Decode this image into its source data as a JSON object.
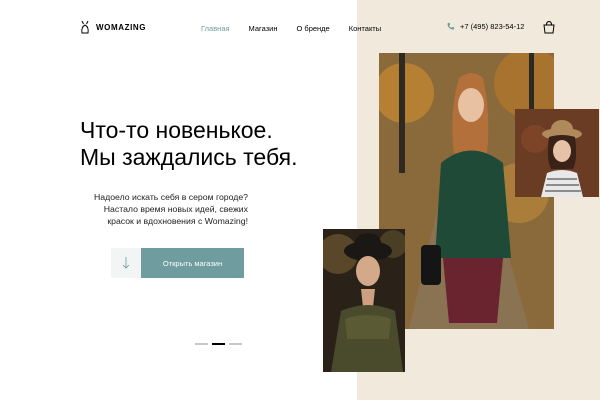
{
  "header": {
    "logo_text": "WOMAZING",
    "nav": [
      "Главная",
      "Магазин",
      "О бренде",
      "Контакты"
    ],
    "active_nav_index": 0,
    "phone": "+7 (495) 823-54-12",
    "phone_icon": "phone-icon",
    "cart_icon": "shopping-bag-icon"
  },
  "hero": {
    "title_lines": [
      "Что-то новенькое.",
      "Мы заждались тебя."
    ],
    "subtitle_lines": [
      "Надоело искать себя в сером городе?",
      "Настало время новых идей, свежих",
      "красок и вдохновения с Womazing!"
    ],
    "arrow_icon": "arrow-down-icon",
    "cta_label": "Открыть магазин"
  },
  "slider": {
    "dots": 3,
    "active": 1
  },
  "colors": {
    "accent": "#6e9c9f",
    "beige": "#f1eadc",
    "text": "#000000"
  }
}
